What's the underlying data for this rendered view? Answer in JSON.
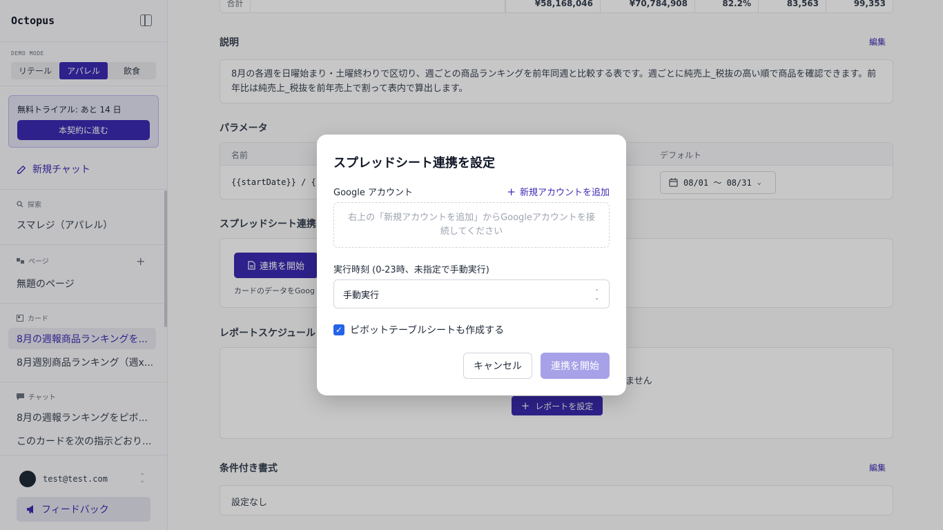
{
  "sidebar": {
    "brand": "Octopus",
    "demo_mode_label": "DEMO MODE",
    "modes": [
      "リテール",
      "アパレル",
      "飲食"
    ],
    "active_mode": "アパレル",
    "trial_text": "無料トライアル: あと 14 日",
    "trial_button": "本契約に進む",
    "new_chat": "新規チャット",
    "sections": {
      "search": {
        "label": "探索",
        "items": [
          "スマレジ（アパレル）"
        ]
      },
      "pages": {
        "label": "ページ",
        "items": [
          "無題のページ"
        ]
      },
      "cards": {
        "label": "カード",
        "items": [
          "8月の週報商品ランキングを...",
          "8月週別商品ランキング（週x..."
        ]
      },
      "chats": {
        "label": "チャット",
        "items": [
          "8月の週報ランキングをピボ...",
          "このカードを次の指示どおり..."
        ]
      }
    },
    "user_email": "test@test.com",
    "feedback": "フィードバック"
  },
  "main": {
    "table_top": {
      "label": "合計",
      "values": [
        "¥58,168,046",
        "¥70,784,908",
        "82.2%",
        "83,563",
        "99,353"
      ]
    },
    "description": {
      "title": "説明",
      "edit": "編集",
      "text": "8月の各週を日曜始まり・土曜終わりで区切り、週ごとの商品ランキングを前年同週と比較する表です。週ごとに純売上_税抜の高い順で商品を確認できます。前年比は純売上_税抜を前年売上で割って表内で算出します。"
    },
    "parameters": {
      "title": "パラメータ",
      "col_name": "名前",
      "col_default": "デフォルト",
      "row_name": "{{startDate}} / {{",
      "row_default": "08/01 〜 08/31"
    },
    "spreadsheet": {
      "title": "スプレッドシート連携",
      "button": "連携を開始",
      "note": "カードのデータをGoog"
    },
    "schedule": {
      "title": "レポートスケジュール",
      "empty_text": "ません",
      "button": "レポートを設定"
    },
    "conditional": {
      "title": "条件付き書式",
      "edit": "編集",
      "text": "設定なし"
    }
  },
  "modal": {
    "title": "スプレッドシート連携を設定",
    "account_label": "Google アカウント",
    "add_account": "新規アカウントを追加",
    "empty_text": "右上の「新規アカウントを追加」からGoogleアカウントを接続してください",
    "time_label": "実行時刻 (0-23時、未指定で手動実行)",
    "time_value": "手動実行",
    "checkbox_label": "ピボットテーブルシートも作成する",
    "checkbox_checked": true,
    "cancel": "キャンセル",
    "start": "連携を開始"
  },
  "colors": {
    "accent": "#3b2bb3",
    "accent_disabled": "#a7a1e8",
    "checkbox": "#2563eb"
  }
}
